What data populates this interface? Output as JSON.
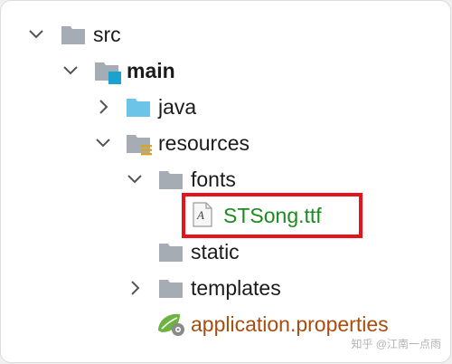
{
  "tree": {
    "items": [
      {
        "label": "src",
        "icon": "folder-icon",
        "state": "expanded"
      },
      {
        "label": "main",
        "icon": "source-root-folder-icon",
        "state": "expanded"
      },
      {
        "label": "java",
        "icon": "folder-icon",
        "state": "collapsed"
      },
      {
        "label": "resources",
        "icon": "resources-folder-icon",
        "state": "expanded"
      },
      {
        "label": "fonts",
        "icon": "folder-icon",
        "state": "expanded"
      },
      {
        "label": "STSong.ttf",
        "icon": "font-file-icon",
        "state": "leaf"
      },
      {
        "label": "static",
        "icon": "folder-icon",
        "state": "leaf"
      },
      {
        "label": "templates",
        "icon": "folder-icon",
        "state": "collapsed"
      },
      {
        "label": "application.properties",
        "icon": "spring-config-icon",
        "state": "leaf"
      }
    ]
  },
  "highlight": {
    "target": "STSong.ttf",
    "color": "#e8131a"
  },
  "font_file_glyph": "A",
  "watermark": "知乎 @江南一点雨",
  "colors": {
    "folder_gray": "#a6acb3",
    "java_folder_blue": "#6cc4e8",
    "source_root_marker": "#1aa3d1",
    "file_green": "#1d8a1d",
    "properties_orange": "#a64d10",
    "spring_green": "#6cb440"
  }
}
